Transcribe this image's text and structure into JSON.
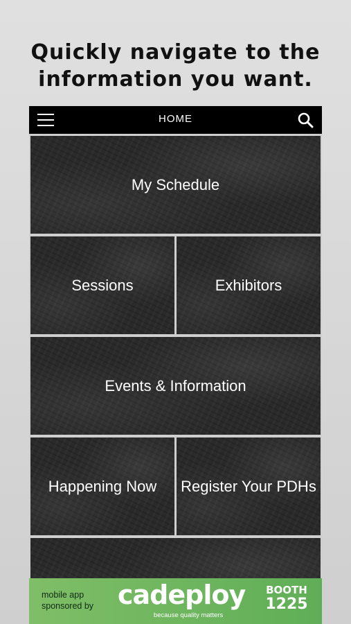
{
  "headline": {
    "line1": "Quickly navigate to the",
    "line2": "information you want."
  },
  "topbar": {
    "title": "HOME",
    "menu_icon": "hamburger-menu-icon",
    "search_icon": "search-icon"
  },
  "tiles": {
    "my_schedule": "My Schedule",
    "sessions": "Sessions",
    "exhibitors": "Exhibitors",
    "events_information": "Events & Information",
    "happening_now": "Happening Now",
    "register_pdhs": "Register Your PDHs"
  },
  "sponsor": {
    "text_line1": "mobile app",
    "text_line2": "sponsored by",
    "brand": "cadeploy",
    "tagline": "because quality matters",
    "booth_label": "BOOTH",
    "booth_number": "1225"
  },
  "colors": {
    "topbar_bg": "#000000",
    "tile_bg": "#2a2a2a",
    "sponsor_green": "#6cb65f"
  }
}
